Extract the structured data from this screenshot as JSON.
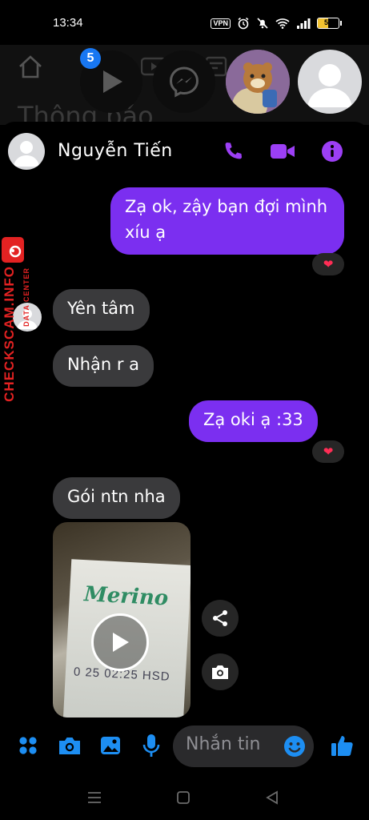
{
  "status_bar": {
    "time": "13:34",
    "vpn_label": "VPN",
    "battery_level": "50",
    "battery_fraction": 0.5,
    "icons": [
      "vpn-icon",
      "alarm-icon",
      "mute-icon",
      "wifi-icon",
      "signal-icon",
      "battery-icon"
    ]
  },
  "background_app": {
    "title": "Thông báo",
    "icons": [
      "home-icon",
      "video-icon",
      "store-icon",
      "search-icon"
    ]
  },
  "chat_heads": {
    "badge_count": "5",
    "heads": [
      "play-video-head",
      "messenger-head",
      "bear-avatar-head",
      "user-avatar-head"
    ]
  },
  "chat": {
    "contact_name": "Nguyễn Tiến",
    "header_icons": [
      "phone-icon",
      "video-call-icon",
      "info-icon"
    ],
    "messages": [
      {
        "direction": "out",
        "text": "Zạ ok, zậy bạn đợi mình xíu ạ",
        "reaction": "❤"
      },
      {
        "direction": "in",
        "text": "Yên tâm"
      },
      {
        "direction": "in",
        "text": "Nhận r a"
      },
      {
        "direction": "out",
        "text": "Zạ oki ạ :33",
        "reaction": "❤"
      },
      {
        "direction": "in",
        "text": "Gói ntn nha"
      }
    ],
    "video": {
      "brand_text": "Merino",
      "date_text": "0 25 02:25 HSD",
      "actions": [
        "share-icon",
        "camera-icon"
      ]
    }
  },
  "watermark": {
    "main": "CHECKSCAM.INFO",
    "sub": "DATA CENTER"
  },
  "composer": {
    "placeholder": "Nhắn tin",
    "icons": [
      "apps-icon",
      "camera-icon",
      "gallery-icon",
      "mic-icon",
      "emoji-icon",
      "like-icon"
    ]
  },
  "nav_bar": {
    "buttons": [
      "recent-apps",
      "home",
      "back"
    ]
  },
  "colors": {
    "accent": "#7b2ff0",
    "icon_purple": "#9c3ff5",
    "composer_blue": "#1d8ef2",
    "heart": "#ff2d55",
    "watermark_red": "#e32222"
  }
}
